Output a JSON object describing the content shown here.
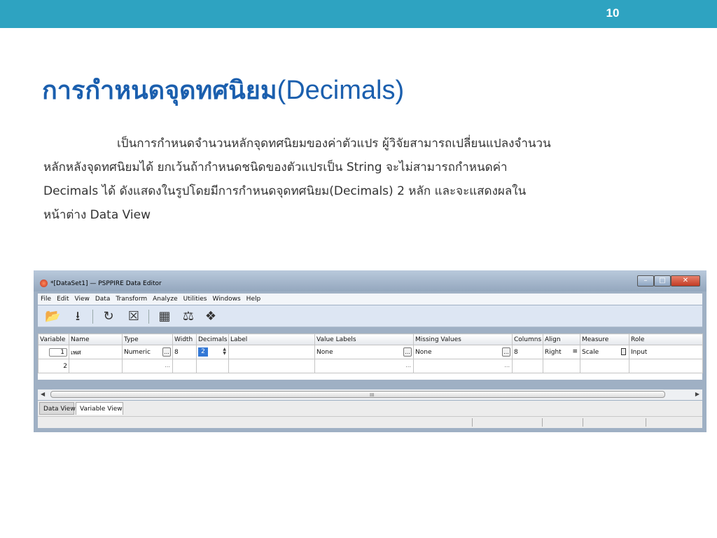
{
  "slide": {
    "number": "10",
    "title_thai": "การกำหนดจุดทศนิยม",
    "title_en": "(Decimals)",
    "body_lines": [
      "เป็นการกำหนดจำนวนหลักจุดทศนิยมของค่าตัวแปร ผู้วิจัยสามารถเปลี่ยนแปลงจำนวน",
      "หลักหลังจุดทศนิยมได้ ยกเว้นถ้ากำหนดชนิดของตัวแปรเป็น String จะไม่สามารถกำหนดค่า",
      "Decimals ได้ ดังแสดงในรูปโดยมีการกำหนดจุดทศนิยม(Decimals) 2 หลัก และจะแสดงผลใน",
      "หน้าต่าง Data View"
    ],
    "colors": {
      "topbar": "#2ea3c1",
      "title": "#1b5fae"
    }
  },
  "window": {
    "title": "*[DataSet1] — PSPPIRE Data Editor",
    "buttons": {
      "minimize": "–",
      "maximize": "□",
      "close": "✕"
    },
    "menu": [
      "File",
      "Edit",
      "View",
      "Data",
      "Transform",
      "Analyze",
      "Utilities",
      "Windows",
      "Help"
    ],
    "toolbar_icons": [
      "open-file-icon",
      "save-icon",
      "goto-case-icon",
      "delete-icon",
      "split-file-icon",
      "weight-cases-icon",
      "value-labels-icon"
    ],
    "columns": [
      "Variable",
      "Name",
      "Type",
      "Width",
      "Decimals",
      "Label",
      "Value Labels",
      "Missing Values",
      "Columns",
      "Align",
      "Measure",
      "Role"
    ],
    "rows": [
      {
        "num": "1",
        "name": "เพศ",
        "type": "Numeric",
        "width": "8",
        "decimals": "2",
        "label": "",
        "value_labels": "None",
        "missing_values": "None",
        "columns": "8",
        "align": "Right",
        "measure": "Scale",
        "role": "Input"
      },
      {
        "num": "2",
        "dots": "..."
      }
    ],
    "tabs": [
      "Data View",
      "Variable View"
    ],
    "scroll_mark": "III"
  }
}
